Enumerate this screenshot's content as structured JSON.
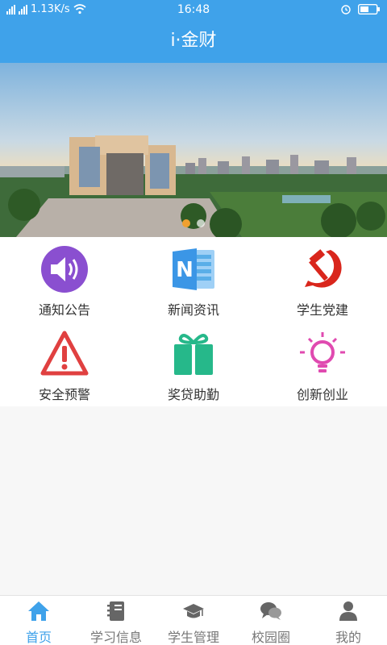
{
  "status": {
    "network_speed": "1.13K/s",
    "time": "16:48"
  },
  "header": {
    "title": "i·金财"
  },
  "banner": {
    "slide_count": 2,
    "active_slide": 1
  },
  "menu": [
    {
      "label": "通知公告",
      "icon": "speaker-icon"
    },
    {
      "label": "新闻资讯",
      "icon": "onenote-icon"
    },
    {
      "label": "学生党建",
      "icon": "hammer-sickle-icon"
    },
    {
      "label": "安全预警",
      "icon": "warning-icon"
    },
    {
      "label": "奖贷助勤",
      "icon": "gift-icon"
    },
    {
      "label": "创新创业",
      "icon": "lightbulb-icon"
    }
  ],
  "tabs": [
    {
      "label": "首页",
      "icon": "home-icon",
      "active": true
    },
    {
      "label": "学习信息",
      "icon": "notebook-icon",
      "active": false
    },
    {
      "label": "学生管理",
      "icon": "graduation-cap-icon",
      "active": false
    },
    {
      "label": "校园圈",
      "icon": "chat-bubbles-icon",
      "active": false
    },
    {
      "label": "我的",
      "icon": "person-icon",
      "active": false
    }
  ],
  "colors": {
    "primary": "#3fa2ea",
    "speaker": "#8a4fd0",
    "onenote": "#3b96e6",
    "party": "#d9261c",
    "warning": "#e04040",
    "gift": "#26b88a",
    "bulb": "#e04ab0"
  }
}
